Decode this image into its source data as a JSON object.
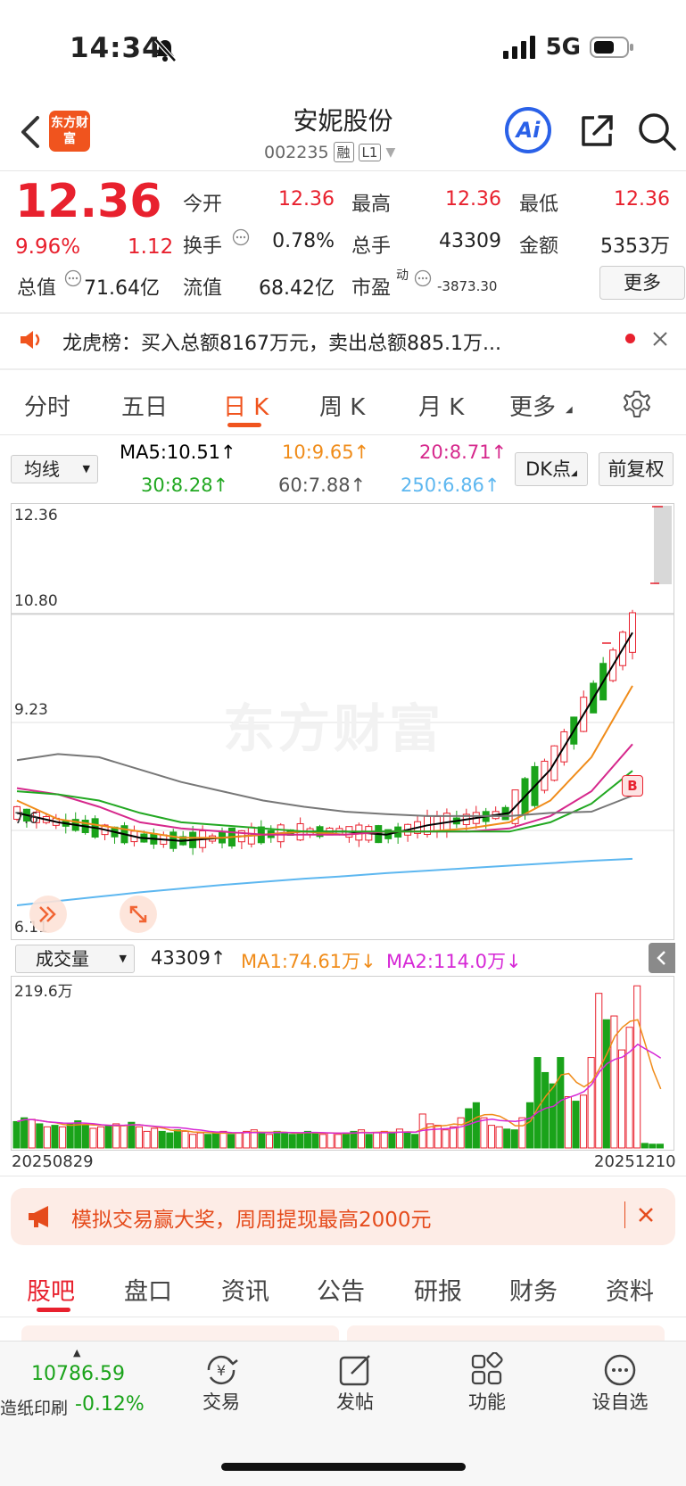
{
  "status": {
    "time": "14:34",
    "network": "5G"
  },
  "header": {
    "app_logo": "东方财富",
    "title": "安妮股份",
    "code": "002235",
    "tag1": "融",
    "tag2": "L1",
    "ai_label": "Ai"
  },
  "quote": {
    "price": "12.36",
    "change_pct": "9.96%",
    "change": "1.12",
    "open_label": "今开",
    "open": "12.36",
    "high_label": "最高",
    "high": "12.36",
    "low_label": "最低",
    "low": "12.36",
    "turnover_label": "换手",
    "turnover": "0.78%",
    "volume_label": "总手",
    "volume": "43309",
    "amount_label": "金额",
    "amount": "5353万",
    "mktcap_label": "总值",
    "mktcap": "71.64亿",
    "float_label": "流值",
    "float": "68.42亿",
    "pe_label": "市盈",
    "pe_sup": "动",
    "pe": "-3873.30",
    "more": "更多"
  },
  "notice": {
    "text": "龙虎榜：买入总额8167万元，卖出总额885.1万..."
  },
  "tabs": [
    "分时",
    "五日",
    "日 K",
    "周 K",
    "月 K",
    "更多"
  ],
  "ma_row": {
    "select": "均线",
    "ma5": "MA5:10.51↑",
    "ma10": "10:9.65↑",
    "ma20": "20:8.71↑",
    "ma30": "30:8.28↑",
    "ma60": "60:7.88↑",
    "ma250": "250:6.86↑",
    "dk": "DK点",
    "fq": "前复权"
  },
  "chart": {
    "y_labels": [
      "12.36",
      "10.80",
      "9.23",
      "7.6",
      "6.11"
    ],
    "watermark": "东方财富",
    "b_marker": "B",
    "vol_select": "成交量",
    "vol_now": "43309↑",
    "vol_ma1": "MA1:74.61万↓",
    "vol_ma2": "MA2:114.0万↓",
    "vol_max": "219.6万",
    "date_start": "20250829",
    "date_end": "20251210"
  },
  "colors": {
    "ma5": "#000000",
    "ma10": "#f08c1a",
    "ma20": "#d6288c",
    "ma30": "#22a822",
    "ma60": "#777777",
    "ma250": "#5db7f0",
    "up": "#e8212e",
    "down": "#1aa31a"
  },
  "chart_data": [
    {
      "type": "line",
      "title": "",
      "x": [
        "20250829",
        "20251210"
      ],
      "ylim": [
        6.11,
        12.36
      ],
      "series": [
        {
          "name": "MA5",
          "values": [
            7.6,
            7.45,
            7.35,
            7.2,
            7.15,
            7.2,
            7.25,
            7.3,
            7.3,
            7.25,
            7.4,
            7.5,
            7.6,
            8.3,
            9.4,
            10.51
          ]
        },
        {
          "name": "MA10",
          "values": [
            7.8,
            7.5,
            7.4,
            7.3,
            7.2,
            7.2,
            7.25,
            7.3,
            7.25,
            7.3,
            7.3,
            7.35,
            7.45,
            7.8,
            8.5,
            9.65
          ]
        },
        {
          "name": "MA20",
          "values": [
            8.0,
            7.9,
            7.7,
            7.45,
            7.35,
            7.3,
            7.25,
            7.25,
            7.25,
            7.3,
            7.3,
            7.3,
            7.35,
            7.55,
            7.95,
            8.71
          ]
        },
        {
          "name": "MA30",
          "values": [
            7.95,
            7.9,
            7.8,
            7.6,
            7.45,
            7.4,
            7.35,
            7.3,
            7.3,
            7.3,
            7.3,
            7.3,
            7.3,
            7.45,
            7.75,
            8.28
          ]
        },
        {
          "name": "MA60",
          "values": [
            8.45,
            8.55,
            8.5,
            8.3,
            8.1,
            7.95,
            7.8,
            7.7,
            7.62,
            7.58,
            7.55,
            7.55,
            7.55,
            7.6,
            7.62,
            7.88
          ]
        },
        {
          "name": "MA250",
          "values": [
            6.11,
            6.18,
            6.25,
            6.32,
            6.38,
            6.44,
            6.49,
            6.54,
            6.58,
            6.63,
            6.67,
            6.71,
            6.75,
            6.79,
            6.83,
            6.86
          ]
        }
      ]
    },
    {
      "type": "bar",
      "title": "成交量",
      "x": [
        "20250829",
        "20251210"
      ],
      "ylim": [
        0,
        2196000
      ],
      "values": [
        35,
        40,
        38,
        32,
        28,
        30,
        28,
        32,
        36,
        30,
        26,
        28,
        30,
        32,
        30,
        34,
        28,
        22,
        26,
        22,
        20,
        24,
        22,
        18,
        20,
        18,
        20,
        22,
        18,
        20,
        22,
        24,
        20,
        18,
        22,
        20,
        18,
        20,
        22,
        20,
        18,
        20,
        18,
        20,
        22,
        24,
        18,
        20,
        22,
        20,
        25,
        20,
        18,
        45,
        32,
        30,
        24,
        28,
        40,
        52,
        60,
        40,
        30,
        28,
        25,
        24,
        40,
        60,
        120,
        100,
        85,
        120,
        68,
        62,
        70,
        120,
        205,
        170,
        175,
        130,
        160,
        215,
        6,
        5,
        5
      ]
    }
  ]
}
